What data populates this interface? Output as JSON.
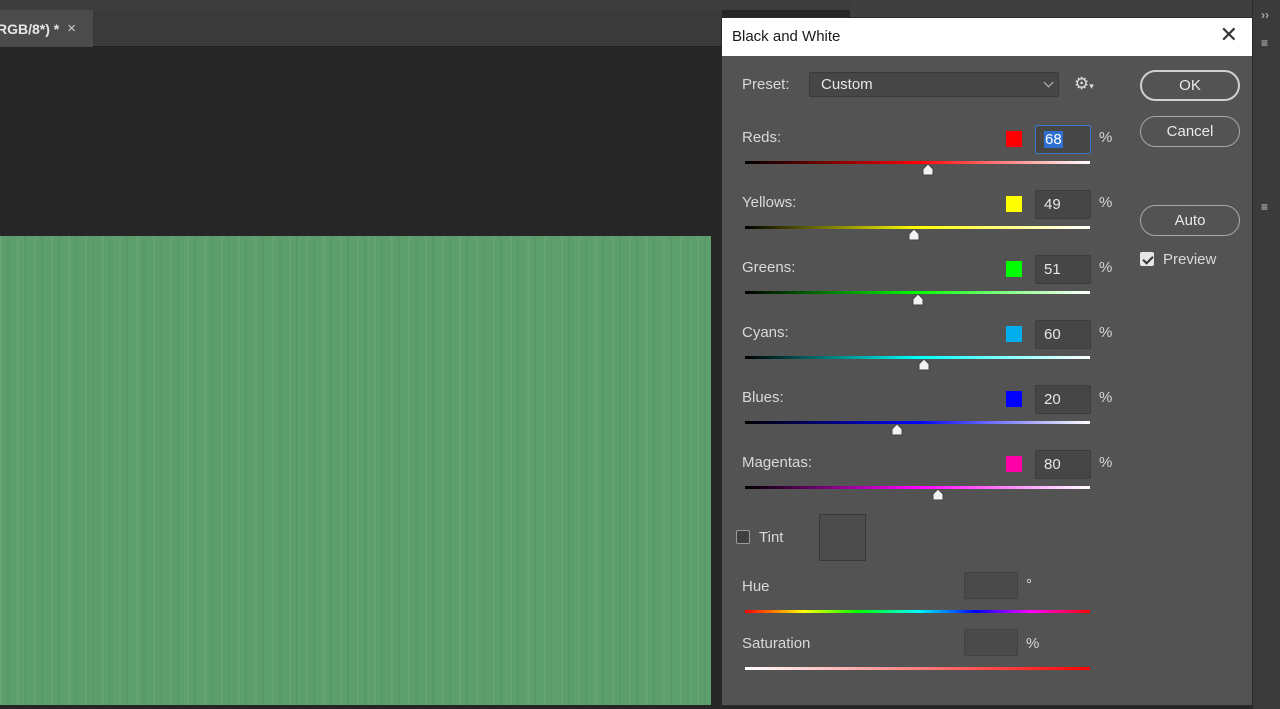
{
  "workspace": {
    "doc_tab": {
      "title": "RGB/8*) *",
      "close_glyph": "×"
    },
    "right_strip_glyphs": [
      "››",
      "≡",
      "≡",
      "≡"
    ]
  },
  "dialog": {
    "title": "Black and White",
    "close_glyph": "✕",
    "preset": {
      "label": "Preset:",
      "value": "Custom"
    },
    "gear_glyph": "⚙",
    "buttons": {
      "ok": "OK",
      "cancel": "Cancel",
      "auto": "Auto"
    },
    "preview": {
      "label": "Preview",
      "checked": true
    },
    "sliders": [
      {
        "label": "Reds:",
        "value": "68",
        "percent": "%",
        "color": "#ff0000",
        "track": "linear-gradient(90deg,#000 0%,#ff0000 50%,#ffffff 100%)",
        "level": 0.53
      },
      {
        "label": "Yellows:",
        "value": "49",
        "percent": "%",
        "color": "#ffff00",
        "track": "linear-gradient(90deg,#000 0%,#ffff00 50%,#ffffff 100%)",
        "level": 0.49
      },
      {
        "label": "Greens:",
        "value": "51",
        "percent": "%",
        "color": "#00ff00",
        "track": "linear-gradient(90deg,#000 0%,#00ff00 50%,#ffffff 100%)",
        "level": 0.5
      },
      {
        "label": "Cyans:",
        "value": "60",
        "percent": "%",
        "color": "#00aeef",
        "track": "linear-gradient(90deg,#000 0%,#00ffff 50%,#ffffff 100%)",
        "level": 0.52
      },
      {
        "label": "Blues:",
        "value": "20",
        "percent": "%",
        "color": "#0000ff",
        "track": "linear-gradient(90deg,#000 0%,#0000ff 50%,#ffffff 100%)",
        "level": 0.44
      },
      {
        "label": "Magentas:",
        "value": "80",
        "percent": "%",
        "color": "#ff00a8",
        "track": "linear-gradient(90deg,#000 0%,#ff00ff 50%,#ffffff 100%)",
        "level": 0.56
      }
    ],
    "tint": {
      "label": "Tint",
      "checked": false
    },
    "hue": {
      "label": "Hue",
      "unit": "°",
      "track": "linear-gradient(90deg,#ff0000 0%,#ffff00 17%,#00ff00 33%,#00ffff 50%,#0000ff 67%,#ff00ff 83%,#ff0000 100%)"
    },
    "saturation": {
      "label": "Saturation",
      "unit": "%",
      "track": "linear-gradient(90deg,#ffffff 0%,#ff0000 100%)"
    }
  }
}
